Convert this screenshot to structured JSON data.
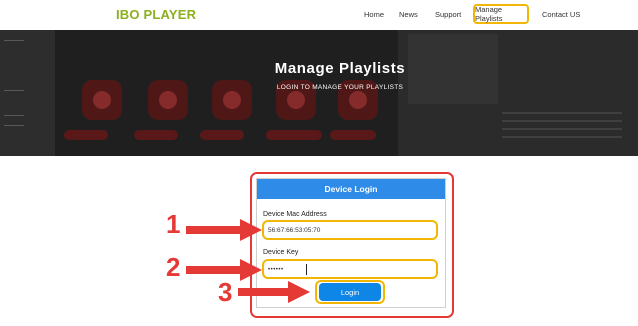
{
  "header": {
    "logo": "IBO PLAYER",
    "nav": {
      "home": "Home",
      "news": "News",
      "support": "Support",
      "manage": "Manage Playlists",
      "contact": "Contact US"
    }
  },
  "hero": {
    "title": "Manage Playlists",
    "subtitle": "LOGIN TO MANAGE YOUR PLAYLISTS"
  },
  "login": {
    "title": "Device Login",
    "mac_label": "Device Mac Address",
    "mac_value": "56:67:66:53:05:70",
    "key_label": "Device Key",
    "key_value": "••••••",
    "button": "Login"
  },
  "annotations": {
    "step1": "1",
    "step2": "2",
    "step3": "3"
  },
  "colors": {
    "brand_green": "#8cae1f",
    "highlight_yellow": "#f2b705",
    "annotation_red": "#e53935",
    "card_header_blue": "#2f8be8",
    "button_blue": "#0d86e8"
  }
}
